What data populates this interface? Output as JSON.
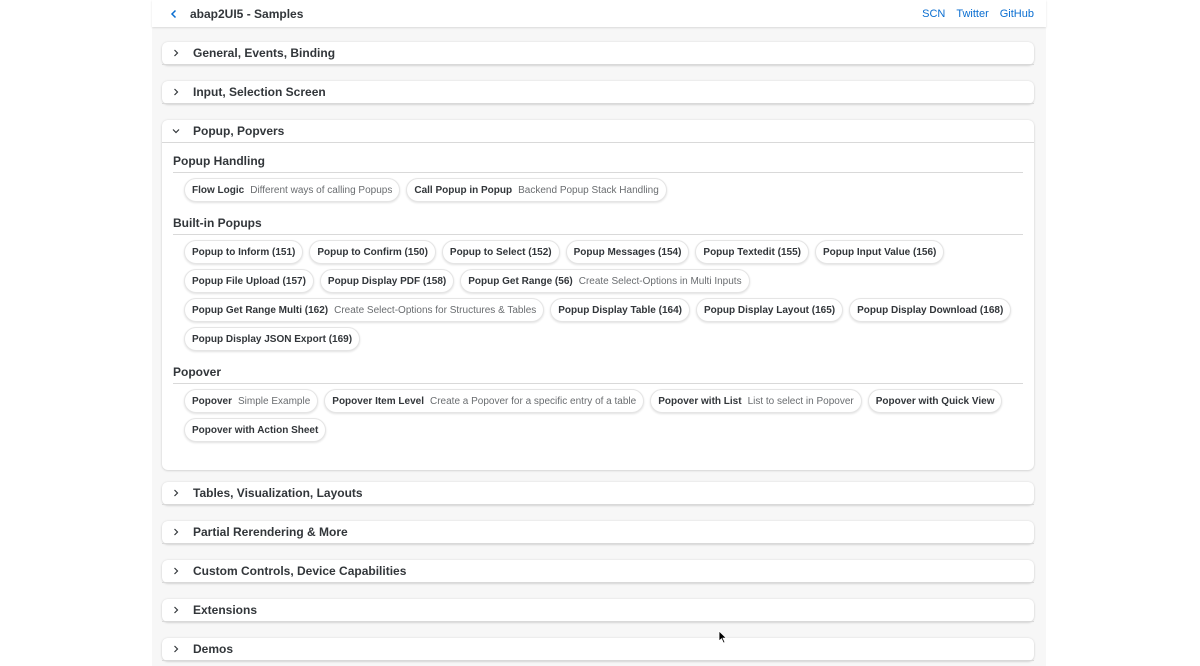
{
  "header": {
    "title": "abap2UI5 - Samples",
    "links": [
      "SCN",
      "Twitter",
      "GitHub"
    ]
  },
  "sections": {
    "general": "General, Events, Binding",
    "input": "Input, Selection Screen",
    "popup": "Popup, Popvers",
    "tables": "Tables, Visualization, Layouts",
    "partial": "Partial Rerendering & More",
    "custom": "Custom Controls, Device Capabilities",
    "extensions": "Extensions",
    "demos": "Demos"
  },
  "groups": {
    "popup_handling": {
      "title": "Popup Handling",
      "tiles": [
        {
          "title": "Flow Logic",
          "sub": "Different ways of calling Popups"
        },
        {
          "title": "Call Popup in Popup",
          "sub": "Backend Popup Stack Handling"
        }
      ]
    },
    "builtin": {
      "title": "Built-in Popups",
      "tiles": [
        {
          "title": "Popup to Inform (151)",
          "sub": ""
        },
        {
          "title": "Popup to Confirm (150)",
          "sub": ""
        },
        {
          "title": "Popup to Select (152)",
          "sub": ""
        },
        {
          "title": "Popup Messages (154)",
          "sub": ""
        },
        {
          "title": "Popup Textedit (155)",
          "sub": ""
        },
        {
          "title": "Popup Input Value (156)",
          "sub": ""
        },
        {
          "title": "Popup File Upload (157)",
          "sub": ""
        },
        {
          "title": "Popup Display PDF (158)",
          "sub": ""
        },
        {
          "title": "Popup Get Range (56)",
          "sub": "Create Select-Options in Multi Inputs"
        },
        {
          "title": "Popup Get Range Multi (162)",
          "sub": "Create Select-Options for Structures & Tables"
        },
        {
          "title": "Popup Display Table (164)",
          "sub": ""
        },
        {
          "title": "Popup Display Layout (165)",
          "sub": ""
        },
        {
          "title": "Popup Display Download (168)",
          "sub": ""
        },
        {
          "title": "Popup Display JSON Export (169)",
          "sub": ""
        }
      ]
    },
    "popover": {
      "title": "Popover",
      "tiles": [
        {
          "title": "Popover",
          "sub": "Simple Example"
        },
        {
          "title": "Popover Item Level",
          "sub": "Create a Popover for a specific entry of a table"
        },
        {
          "title": "Popover with List",
          "sub": "List to select in Popover"
        },
        {
          "title": "Popover with Quick View",
          "sub": ""
        },
        {
          "title": "Popover with Action Sheet",
          "sub": ""
        }
      ]
    }
  },
  "icons": {
    "back": "chevron-left-icon",
    "collapsed": "chevron-right-icon",
    "expanded": "chevron-down-icon",
    "cursor": "mouse-pointer-icon"
  },
  "colors": {
    "link": "#0a6ed1",
    "text": "#32363a",
    "subtext": "#6a6d70",
    "background": "#f7f7f7"
  }
}
